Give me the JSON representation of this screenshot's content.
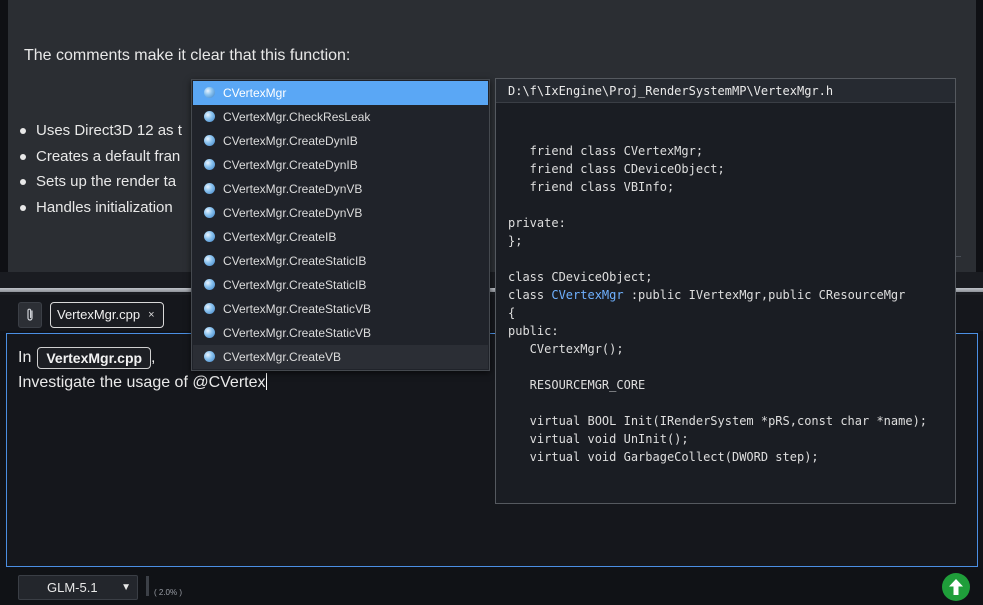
{
  "chat": {
    "intro": "The comments make it clear that this function:",
    "bullets": [
      "Uses Direct3D 12 as t",
      "Creates a default fran",
      "Sets up the render ta",
      "Handles initialization"
    ]
  },
  "attachments": {
    "paperclip_icon": "paperclip-icon",
    "chip_label": "VertexMgr.cpp",
    "chip_close": "×"
  },
  "input": {
    "line1_prefix": "In",
    "file_pill": "VertexMgr.cpp",
    "line1_suffix": ",",
    "line2": "Investigate the usage of @CVertex"
  },
  "completion": {
    "items": [
      "CVertexMgr",
      "CVertexMgr.CheckResLeak",
      "CVertexMgr.CreateDynIB",
      "CVertexMgr.CreateDynIB",
      "CVertexMgr.CreateDynVB",
      "CVertexMgr.CreateDynVB",
      "CVertexMgr.CreateIB",
      "CVertexMgr.CreateStaticIB",
      "CVertexMgr.CreateStaticIB",
      "CVertexMgr.CreateStaticVB",
      "CVertexMgr.CreateStaticVB",
      "CVertexMgr.CreateVB"
    ],
    "selected_index": 0
  },
  "preview": {
    "path": "D:\\f\\IxEngine\\Proj_RenderSystemMP\\VertexMgr.h",
    "lines": [
      "   friend class CVertexMgr;",
      "   friend class CDeviceObject;",
      "   friend class VBInfo;",
      "",
      "private:",
      "};",
      "",
      "class CDeviceObject;",
      "class CVertexMgr :public IVertexMgr,public CResourceMgr",
      "{",
      "public:",
      "   CVertexMgr();",
      "",
      "   RESOURCEMGR_CORE",
      "",
      "   virtual BOOL Init(IRenderSystem *pRS,const char *name);",
      "   virtual void UnInit();",
      "   virtual void GarbageCollect(DWORD step);"
    ],
    "highlight_token": "CVertexMgr",
    "highlight_line": 8
  },
  "bottom": {
    "model": "GLM-5.1",
    "context_usage": "( 2.0% )",
    "send_icon": "arrow-up-icon"
  },
  "colors": {
    "accent": "#4b8fe3",
    "selection": "#5aa7f5",
    "send": "#1f9e3a",
    "highlight": "#6fb1ff"
  }
}
